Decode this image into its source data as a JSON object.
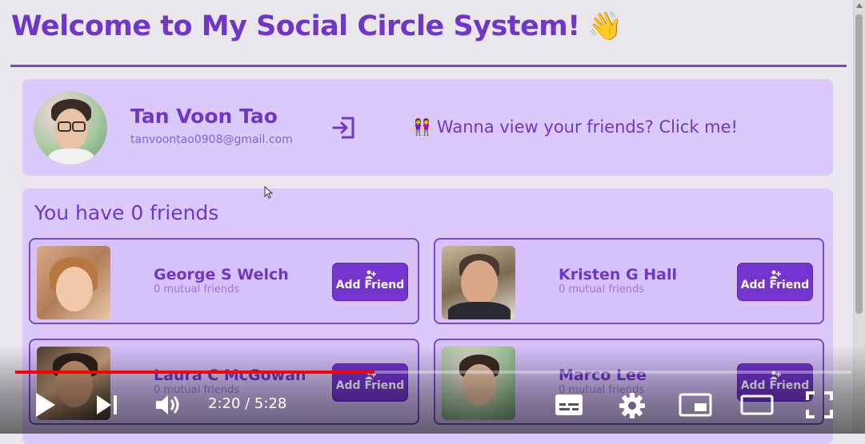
{
  "page": {
    "title": "Welcome to My Social Circle System!",
    "title_emoji": "👋"
  },
  "profile": {
    "name": "Tan Voon Tao",
    "email": "tanvoontao0908@gmail.com",
    "friends_link_emoji": "👭",
    "friends_link": "Wanna view your friends? Click me!"
  },
  "friends_section": {
    "heading": "You have 0 friends",
    "suggestions": [
      {
        "name": "George S Welch",
        "mutual": "0 mutual friends",
        "button": "Add Friend"
      },
      {
        "name": "Kristen G Hall",
        "mutual": "0 mutual friends",
        "button": "Add Friend"
      },
      {
        "name": "Laura C McGowan",
        "mutual": "0 mutual friends",
        "button": "Add Friend"
      },
      {
        "name": "Marco Lee",
        "mutual": "0 mutual friends",
        "button": "Add Friend"
      }
    ]
  },
  "player": {
    "time": "2:20 / 5:28",
    "progress": 0.43
  },
  "colors": {
    "accent": "#6f36c9",
    "card_bg": "#dcc9fb",
    "button": "#7434cf",
    "progress": "#ff0000"
  }
}
